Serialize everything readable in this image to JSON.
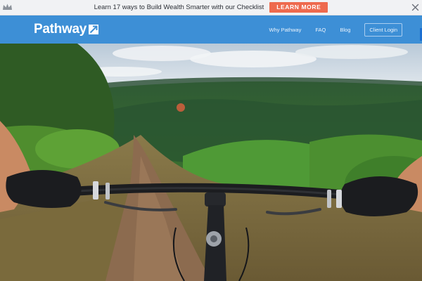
{
  "promo": {
    "text": "Learn 17 ways to Build Wealth Smarter with our Checklist",
    "button_label": "LEARN MORE",
    "icon": "crown-icon",
    "close_icon": "close-icon"
  },
  "brand": {
    "name": "Pathway",
    "color": "#3d8fd6",
    "accent": "#ee6a4e"
  },
  "nav": {
    "links": [
      "Why Pathway",
      "FAQ",
      "Blog"
    ],
    "login_label": "Client Login"
  },
  "hero": {
    "description_icon": "mountain-bike-photo"
  }
}
